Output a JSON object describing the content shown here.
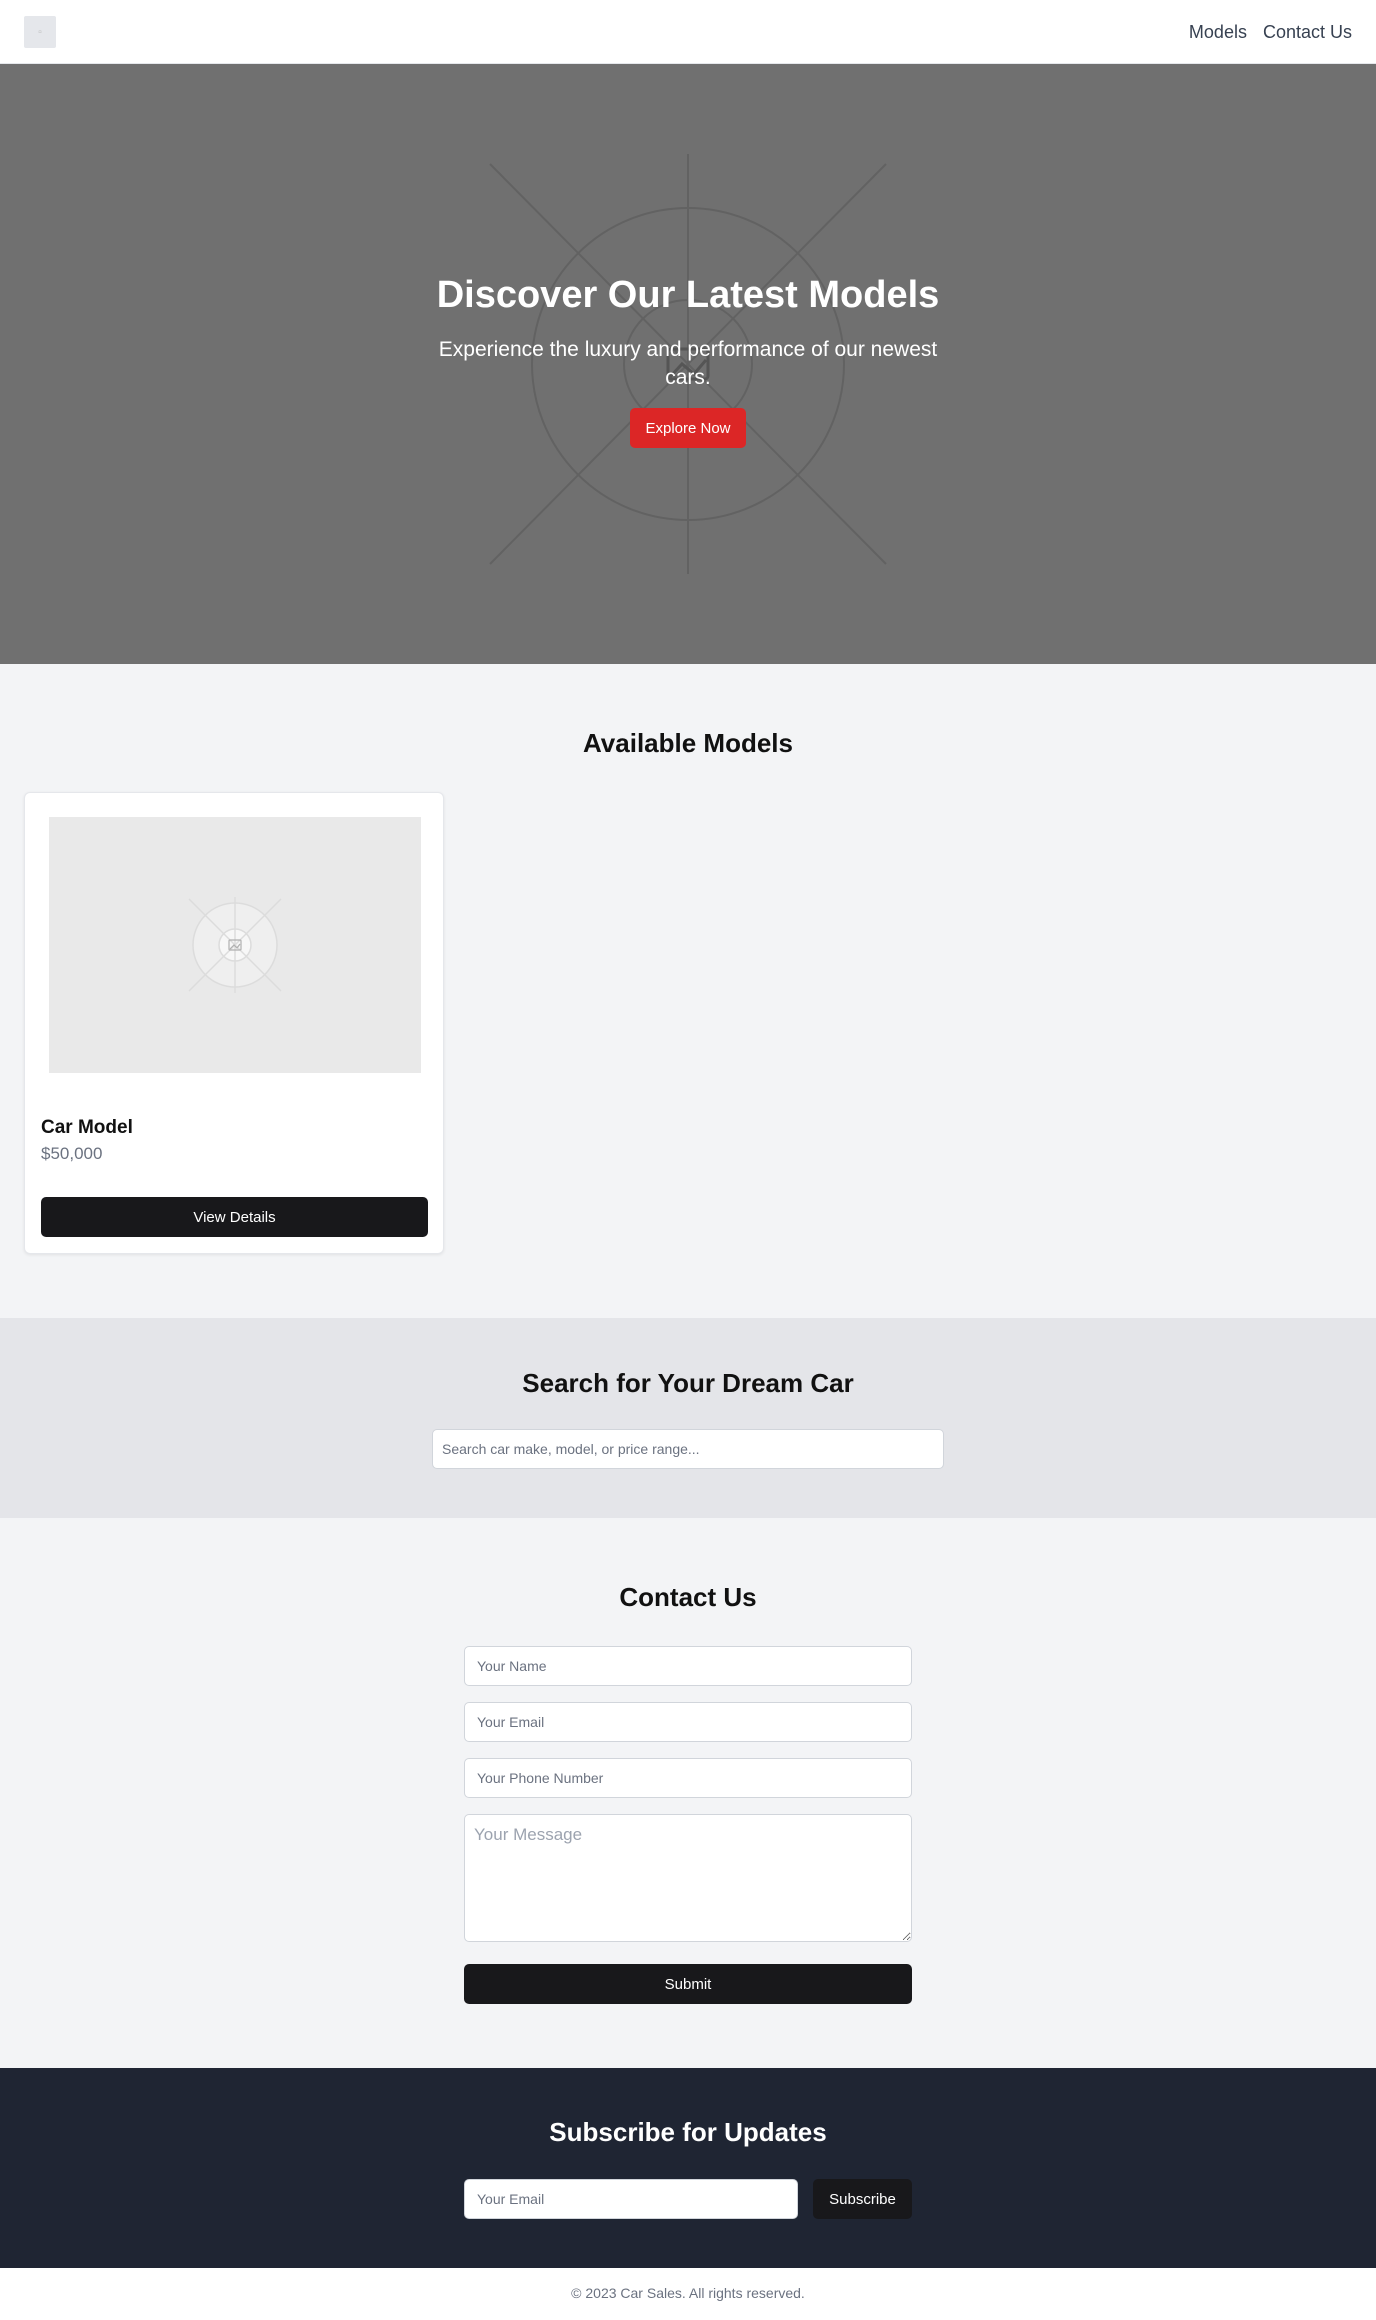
{
  "header": {
    "nav": [
      {
        "label": "Models"
      },
      {
        "label": "Contact Us"
      }
    ]
  },
  "hero": {
    "title": "Discover Our Latest Models",
    "subtitle": "Experience the luxury and performance of our newest cars.",
    "cta_label": "Explore Now"
  },
  "models": {
    "title": "Available Models",
    "cards": [
      {
        "name": "Car Model",
        "price": "$50,000",
        "button_label": "View Details"
      }
    ]
  },
  "search": {
    "title": "Search for Your Dream Car",
    "placeholder": "Search car make, model, or price range..."
  },
  "contact": {
    "title": "Contact Us",
    "name_placeholder": "Your Name",
    "email_placeholder": "Your Email",
    "phone_placeholder": "Your Phone Number",
    "message_placeholder": "Your Message",
    "submit_label": "Submit"
  },
  "subscribe": {
    "title": "Subscribe for Updates",
    "email_placeholder": "Your Email",
    "button_label": "Subscribe"
  },
  "footer": {
    "copyright": "© 2023 Car Sales. All rights reserved."
  },
  "colors": {
    "accent_red": "#dc2626",
    "button_dark": "#18181b",
    "subscribe_bg": "#1f2533",
    "hero_bg": "#707070"
  },
  "icons": {
    "logo": "broken-image-icon",
    "hero_image": "image-placeholder-icon",
    "card_image": "image-placeholder-icon"
  }
}
